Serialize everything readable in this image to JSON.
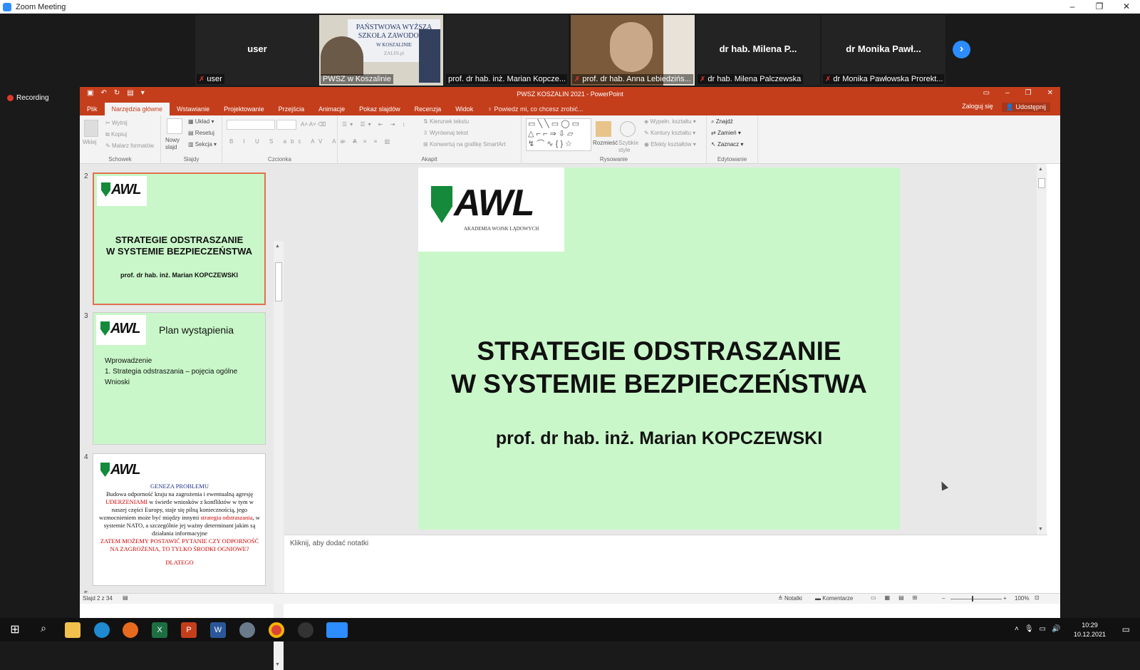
{
  "window": {
    "title": "Zoom Meeting",
    "recording_label": "Recording"
  },
  "participants": [
    {
      "big": "user",
      "label": "user",
      "muted": true
    },
    {
      "big": "",
      "label": "PWSZ w Koszalinie",
      "muted": false,
      "video": "school banner with presenter"
    },
    {
      "big": "",
      "label": "prof. dr hab. inż. Marian Kopcze...",
      "muted": false
    },
    {
      "big": "",
      "label": "prof. dr hab. Anna Lebiedzińs...",
      "muted": true,
      "video": "participant webcam"
    },
    {
      "big": "dr hab. Milena P...",
      "label": "dr hab. Milena Palczewska",
      "muted": true
    },
    {
      "big": "dr Monika Pawł...",
      "label": "dr Monika Pawłowska Prorekt...",
      "muted": true
    }
  ],
  "banner_text": {
    "line1": "PAŃSTWOWA WYŻSZA",
    "line2": "SZKOŁA ZAWODOWA",
    "line3": "W KOSZALINIE",
    "line4": "ZALIN.pl"
  },
  "ppt": {
    "title": "PWSZ KOSZALIN 2021 - PowerPoint",
    "tabs": [
      "Plik",
      "Narzędzia główne",
      "Wstawianie",
      "Projektowanie",
      "Przejścia",
      "Animacje",
      "Pokaz slajdów",
      "Recenzja",
      "Widok"
    ],
    "active_tab": "Narzędzia główne",
    "tell_me": "Powiedz mi, co chcesz zrobić...",
    "sign_in": "Zaloguj się",
    "share": "Udostępnij",
    "ribbon": {
      "clipboard": {
        "label": "Schowek",
        "paste": "Wklej",
        "cut": "Wytnij",
        "copy": "Kopiuj",
        "format_painter": "Malarz formatów"
      },
      "slides": {
        "label": "Slajdy",
        "new_slide": "Nowy slajd",
        "layout": "Układ",
        "reset": "Resetuj",
        "section": "Sekcja"
      },
      "font": {
        "label": "Czcionka"
      },
      "paragraph": {
        "label": "Akapit",
        "text_direction": "Kierunek tekstu",
        "align_text": "Wyrównaj tekst",
        "smartart": "Konwertuj na grafikę SmartArt"
      },
      "drawing": {
        "label": "Rysowanie",
        "arrange": "Rozmieść",
        "quick_styles": "Szybkie style",
        "fill": "Wypełn. kształtu",
        "outline": "Kontury kształtu",
        "effects": "Efekty kształtów"
      },
      "editing": {
        "label": "Edytowanie",
        "find": "Znajdź",
        "replace": "Zamień",
        "select": "Zaznacz"
      }
    },
    "thumbnails": [
      {
        "num": "2",
        "title_line1": "STRATEGIE ODSTRASZANIE",
        "title_line2": "W SYSTEMIE BEZPIECZEŃSTWA",
        "author": "prof. dr hab. inż. Marian KOPCZEWSKI"
      },
      {
        "num": "3",
        "title": "Plan wystąpienia",
        "items": [
          "Wprowadzenie",
          "1.  Strategia odstraszania – pojęcia ogólne",
          "Wnioski"
        ]
      },
      {
        "num": "4",
        "heading": "GENEZA PROBLEMU",
        "p1": "Budowa odporność kraju na zagrożenia i ewentualną agresję",
        "p2": "UDERZENIAMI",
        "p3": "w świetle wniosków",
        "p4": "z konfliktów w tym w naszej części Europy, staje się pilną koniecznością, jego wzmocnieniem może być między innymi",
        "p5": "strategia odstraszania",
        "p6": ", w systemie NATO, a szczególnie jej ważny determinant jakim są działania informacyjne",
        "p7": "ZATEM MOŻEMY POSTAWIĆ PYTANIE CZY ODPORNOŚĆ NA ZAGROŻENIA, TO TYLKO ŚRODKI OGNIOWE?",
        "p8": "DLATEGO"
      },
      {
        "num": "5"
      }
    ],
    "slide": {
      "logo_text": "AWL",
      "logo_sub": "AKADEMIA WOJSK LĄDOWYCH",
      "title_line1": "STRATEGIE ODSTRASZANIE",
      "title_line2": "W SYSTEMIE BEZPIECZEŃSTWA",
      "author": "prof. dr hab. inż. Marian KOPCZEWSKI"
    },
    "notes_placeholder": "Kliknij, aby dodać notatki",
    "status": {
      "slide_counter": "Slajd 2 z 34",
      "notes": "Notatki",
      "comments": "Komentarze",
      "zoom": "100%"
    }
  },
  "taskbar": {
    "time": "10:29",
    "date": "10.12.2021"
  },
  "colors": {
    "ppt_accent": "#c43e1c",
    "slide_bg": "#c9f7c9",
    "zoom_blue": "#2d8cff",
    "awl_green": "#148a3a"
  }
}
